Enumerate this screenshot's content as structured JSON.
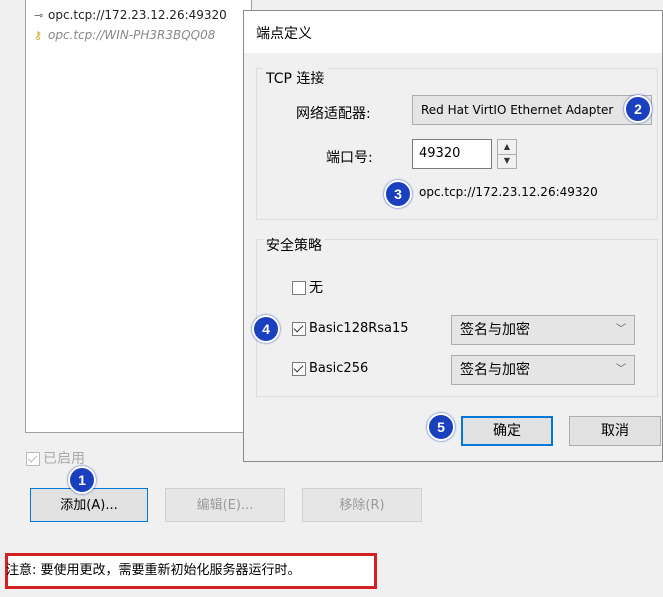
{
  "endpoints": [
    {
      "url": "opc.tcp://172.23.12.26:49320",
      "icon": "plug-icon"
    },
    {
      "url": "opc.tcp://WIN-PH3R3BQQ08",
      "icon": "lock-icon"
    }
  ],
  "enabled": {
    "label": "已启用",
    "checked": true,
    "disabled": true
  },
  "buttons": {
    "add": "添加(A)...",
    "edit": "编辑(E)...",
    "remove": "移除(R)"
  },
  "note": "注意: 要使用更改，需要重新初始化服务器运行时。",
  "dialog": {
    "title": "端点定义",
    "tcp_group": "TCP 连接",
    "adapter_label": "网络适配器:",
    "adapter_value": "Red Hat VirtIO Ethernet Adapter",
    "port_label": "端口号:",
    "port_value": "49320",
    "url": "opc.tcp://172.23.12.26:49320",
    "security_group": "安全策略",
    "policies": [
      {
        "label": "无",
        "checked": false
      },
      {
        "label": "Basic128Rsa15",
        "checked": true,
        "mode": "签名与加密"
      },
      {
        "label": "Basic256",
        "checked": true,
        "mode": "签名与加密"
      }
    ],
    "ok": "确定",
    "cancel": "取消"
  },
  "badges": [
    "1",
    "2",
    "3",
    "4",
    "5"
  ],
  "colors": {
    "accent": "#0078d7",
    "badge": "#1a3fbf",
    "note_border": "#d32020"
  }
}
